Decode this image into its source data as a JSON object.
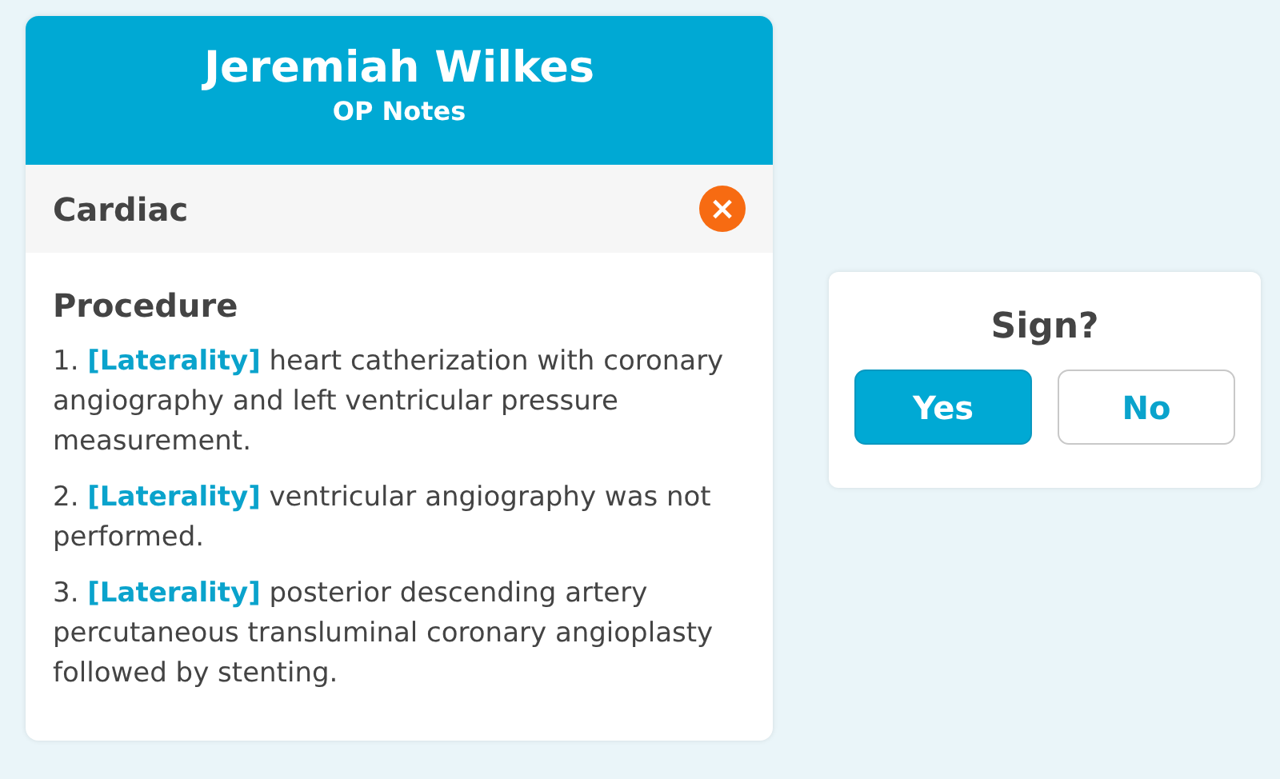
{
  "note_card": {
    "patient_name": "Jeremiah Wilkes",
    "subtitle": "OP Notes",
    "section": {
      "title": "Cardiac",
      "close_icon": "×"
    },
    "heading": "Procedure",
    "steps": [
      {
        "number": "1.",
        "tag": "[Laterality]",
        "text": "heart catherization with coronary angiography and left ventricular pressure measurement."
      },
      {
        "number": "2.",
        "tag": "[Laterality]",
        "text": "ventricular angiography was not performed."
      },
      {
        "number": "3.",
        "tag": "[Laterality]",
        "text": "posterior descending artery percutaneous transluminal coronary angioplasty followed by stenting."
      }
    ]
  },
  "sign_dialog": {
    "question": "Sign?",
    "buttons": [
      {
        "label": "Yes",
        "selected": true
      },
      {
        "label": "No",
        "selected": false
      }
    ]
  }
}
